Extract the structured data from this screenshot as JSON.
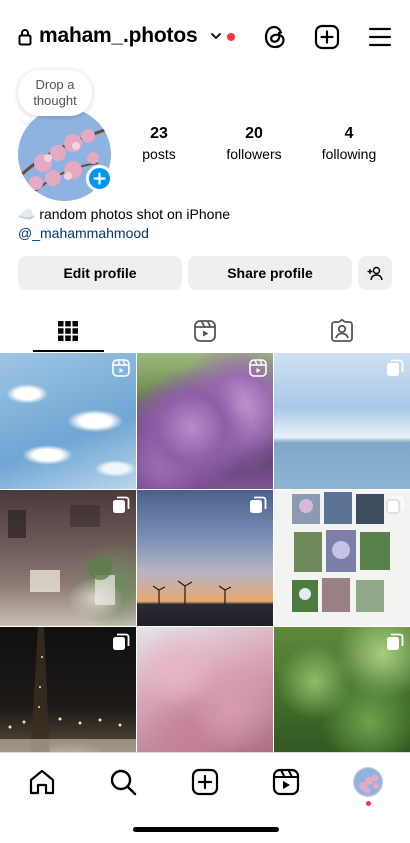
{
  "header": {
    "username": "maham_.photos",
    "icons": [
      "lock-icon",
      "chevron-down-icon",
      "threads-icon",
      "create-post-icon",
      "menu-icon"
    ],
    "notification_dot_color": "#ff3040"
  },
  "profile": {
    "thought_bubble": "Drop a thought",
    "stats": {
      "posts_count": "23",
      "posts_label": "posts",
      "followers_count": "20",
      "followers_label": "followers",
      "following_count": "4",
      "following_label": "following"
    },
    "bio": "☁️ random photos shot on iPhone",
    "bio_link": "@_mahammahmood",
    "add_story_color": "#0095f6"
  },
  "actions": {
    "edit_profile": "Edit profile",
    "share_profile": "Share profile",
    "add_user_icon": "add-user-icon"
  },
  "tabs": {
    "items": [
      "grid-icon",
      "reels-icon",
      "tagged-icon"
    ],
    "active": "grid-icon"
  },
  "grid": {
    "tiles": [
      {
        "subject": "clouds from above",
        "badge": "reel-icon"
      },
      {
        "subject": "purple flowers",
        "badge": "reel-icon"
      },
      {
        "subject": "sea and sky",
        "badge": "carousel-icon"
      },
      {
        "subject": "cozy room interior",
        "badge": "carousel-icon"
      },
      {
        "subject": "sunset with wind turbines",
        "badge": "carousel-icon"
      },
      {
        "subject": "flower collage",
        "badge": "carousel-icon"
      },
      {
        "subject": "night tower lights",
        "badge": "carousel-icon"
      },
      {
        "subject": "pink blossom tree",
        "badge": "none"
      },
      {
        "subject": "green ferns",
        "badge": "carousel-icon"
      }
    ]
  },
  "bottom_nav": {
    "items": [
      "home-icon",
      "search-icon",
      "create-icon",
      "reels-icon",
      "profile-avatar"
    ],
    "profile_dot_color": "#ff3040"
  }
}
